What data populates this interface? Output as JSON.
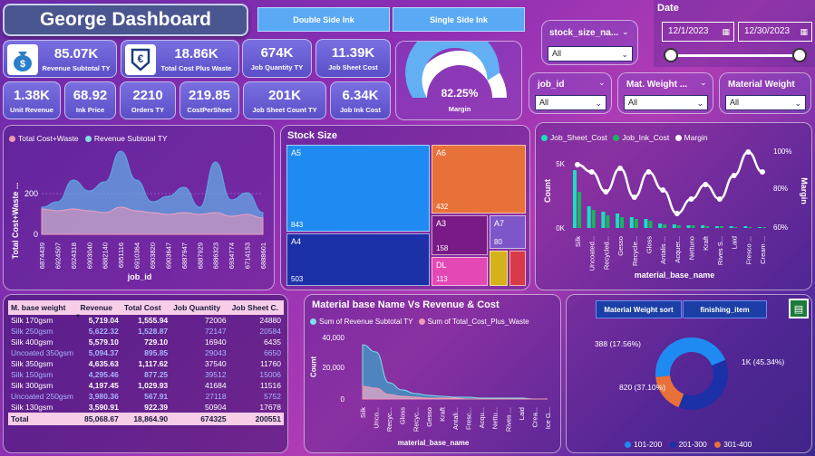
{
  "title": "George Dashboard",
  "ink_buttons": [
    "Double Side Ink",
    "Single Side Ink"
  ],
  "kpis_top": [
    {
      "value": "85.07K",
      "label": "Revenue Subtotal TY"
    },
    {
      "value": "18.86K",
      "label": "Total Cost Plus Waste"
    },
    {
      "value": "674K",
      "label": "Job Quantity TY"
    },
    {
      "value": "11.39K",
      "label": "Job Sheet Cost"
    }
  ],
  "kpis_bottom": [
    {
      "value": "1.38K",
      "label": "Unit Revenue"
    },
    {
      "value": "68.92",
      "label": "Ink Price"
    },
    {
      "value": "2210",
      "label": "Orders TY"
    },
    {
      "value": "219.85",
      "label": "CostPerSheet"
    },
    {
      "value": "201K",
      "label": "Job Sheet Count TY"
    },
    {
      "value": "6.34K",
      "label": "Job Ink Cost"
    }
  ],
  "gauge": {
    "value_text": "82.25%",
    "label": "Margin",
    "fraction": 0.8225,
    "color": "#62b0f3"
  },
  "slicers": {
    "stock_size": {
      "label": "stock_size_na...",
      "value": "All"
    },
    "job_id": {
      "label": "job_id",
      "value": "All"
    },
    "mat_weight": {
      "label": "Mat. Weight ...",
      "value": "All"
    },
    "material_weight": {
      "label": "Material Weight",
      "value": "All"
    },
    "date": {
      "label": "Date",
      "start": "12/1/2023",
      "end": "12/30/2023"
    }
  },
  "area_chart": {
    "legend": [
      "Total Cost+Waste",
      "Revenue Subtotal TY"
    ],
    "ylabel": "Total Cost+Waste ...",
    "xlabel": "job_id",
    "yticks": [
      "200",
      "0"
    ],
    "categories": [
      "6874439",
      "6924507",
      "6924318",
      "6903040",
      "6882140",
      "6951116",
      "6910364",
      "6903820",
      "6903647",
      "6887947",
      "6887929",
      "6886323",
      "6934774",
      "6714153",
      "6888601"
    ]
  },
  "treemap": {
    "title": "Stock Size",
    "cells": [
      {
        "name": "A5",
        "value": "843",
        "color": "#1f8bf2"
      },
      {
        "name": "A6",
        "value": "432",
        "color": "#e8713a"
      },
      {
        "name": "A4",
        "value": "503",
        "color": "#1c30a8"
      },
      {
        "name": "A3",
        "value": "158",
        "color": "#7a1a86"
      },
      {
        "name": "A7",
        "value": "80",
        "color": "#7d57c9"
      },
      {
        "name": "DL",
        "value": "113",
        "color": "#e448b5"
      }
    ]
  },
  "combo_chart": {
    "legend": [
      "Job_Sheet_Cost",
      "Job_Ink_Cost",
      "Margin"
    ],
    "ylabel": "Count",
    "y2label": "Margin",
    "xlabel": "material_base_name",
    "yticks": [
      "5K",
      "0K"
    ],
    "y2ticks": [
      "100%",
      "80%",
      "60%"
    ],
    "categories": [
      "Silk",
      "Uncoated...",
      "Recycled...",
      "Gesso",
      "Recycle...",
      "Gloss",
      "Antalis ...",
      "Acquer...",
      "Nettuno",
      "Kraft",
      "Rives S...",
      "Laid",
      "Fresco ...",
      "Cream ..."
    ]
  },
  "table": {
    "headers": [
      "M. base weight",
      "Revenue",
      "Total Cost",
      "Job Quantity",
      "Job Sheet C."
    ],
    "rows": [
      {
        "name": "Silk 170gsm",
        "rev": "5,719.04",
        "cost": "1,555.94",
        "qty": "72006",
        "sheet": "24880",
        "hl": false
      },
      {
        "name": "Silk 250gsm",
        "rev": "5,622.32",
        "cost": "1,528.87",
        "qty": "72147",
        "sheet": "20584",
        "hl": true
      },
      {
        "name": "Silk 400gsm",
        "rev": "5,579.10",
        "cost": "729.10",
        "qty": "16940",
        "sheet": "6435",
        "hl": false
      },
      {
        "name": "Uncoated 350gsm",
        "rev": "5,094.37",
        "cost": "895.85",
        "qty": "29043",
        "sheet": "6650",
        "hl": true
      },
      {
        "name": "Silk 350gsm",
        "rev": "4,635.63",
        "cost": "1,117.62",
        "qty": "37540",
        "sheet": "11760",
        "hl": false
      },
      {
        "name": "Silk 150gsm",
        "rev": "4,295.46",
        "cost": "877.25",
        "qty": "39512",
        "sheet": "15006",
        "hl": true
      },
      {
        "name": "Silk 300gsm",
        "rev": "4,197.45",
        "cost": "1,029.93",
        "qty": "41684",
        "sheet": "11516",
        "hl": false
      },
      {
        "name": "Uncoated 250gsm",
        "rev": "3,980.36",
        "cost": "567.91",
        "qty": "27118",
        "sheet": "5752",
        "hl": true
      },
      {
        "name": "Silk 130gsm",
        "rev": "3,590.91",
        "cost": "922.39",
        "qty": "50904",
        "sheet": "17678",
        "hl": false
      }
    ],
    "total": {
      "name": "Total",
      "rev": "85,068.67",
      "cost": "18,864.90",
      "qty": "674325",
      "sheet": "200551"
    }
  },
  "area2": {
    "title": "Material base Name Vs Revenue & Cost",
    "legend": [
      "Sum of Revenue Subtotal TY",
      "Sum of Total_Cost_Plus_Waste"
    ],
    "ylabel": "Count",
    "xlabel": "material_base_name",
    "yticks": [
      "40,000",
      "20,000",
      "0"
    ],
    "categories": [
      "Silk",
      "Unco...",
      "Recyc...",
      "Gloss",
      "Recyc...",
      "Gesso",
      "Kraft",
      "Antali...",
      "Fresc...",
      "Acqu...",
      "Nettu...",
      "Rives ...",
      "Laid",
      "Crea...",
      "Ice G..."
    ]
  },
  "donut": {
    "buttons": [
      "Material Weight sort",
      "finishing_item"
    ],
    "segments": [
      {
        "label": "1K (45.34%)",
        "fraction": 0.4534,
        "color": "#1f8bf2"
      },
      {
        "label": "820 (37.10%)",
        "fraction": 0.371,
        "color": "#1c30a8"
      },
      {
        "label": "388 (17.56%)",
        "fraction": 0.1756,
        "color": "#e8713a"
      }
    ],
    "legend": [
      "101-200",
      "201-300",
      "301-400"
    ]
  }
}
